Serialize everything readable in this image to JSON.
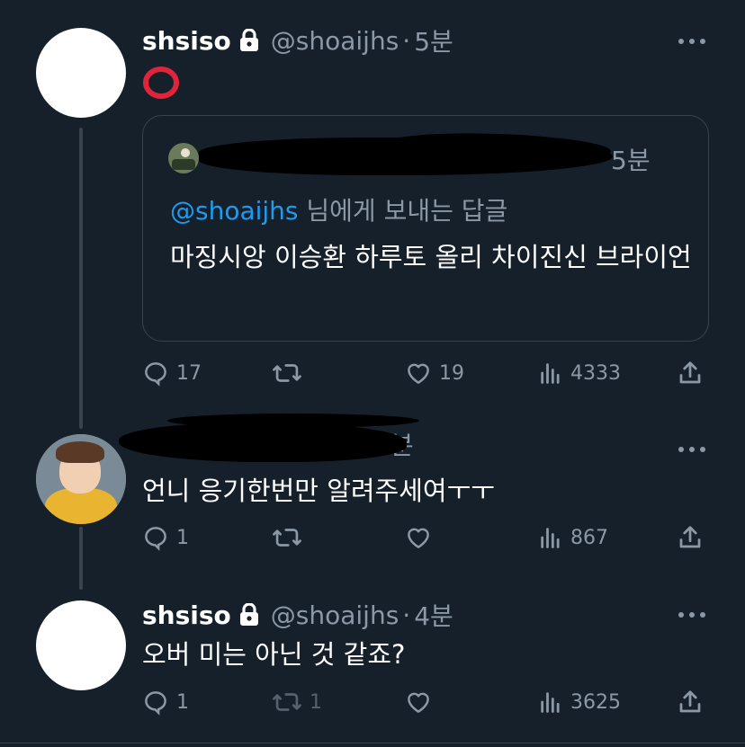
{
  "tweets": [
    {
      "name": "shsiso",
      "handle": "@shoaijhs",
      "separator": "·",
      "time": "5분",
      "text": "⭕",
      "quote": {
        "time": "5분",
        "reply_mention": "@shoaijhs",
        "reply_suffix": " 님에게 보내는 답글",
        "text": "마징시앙 이승환 하루토 올리 차이진신 브라이언"
      },
      "stats": {
        "replies": "17",
        "retweets": "",
        "likes": "19",
        "views": "4333"
      }
    },
    {
      "name": "",
      "handle": "",
      "time": "1분",
      "text": "언니 응기한번만 알려주세여ㅜㅜ",
      "stats": {
        "replies": "1",
        "retweets": "",
        "likes": "",
        "views": "867"
      }
    },
    {
      "name": "shsiso",
      "handle": "@shoaijhs",
      "separator": "·",
      "time": "4분",
      "text": "오버 미는 아닌 것 같죠?",
      "stats": {
        "replies": "1",
        "retweets": "1",
        "likes": "",
        "views": "3625"
      }
    }
  ],
  "colors": {
    "background": "#15202b",
    "secondary_text": "#8b98a5",
    "accent": "#1d9bf0",
    "border": "#38444d"
  }
}
